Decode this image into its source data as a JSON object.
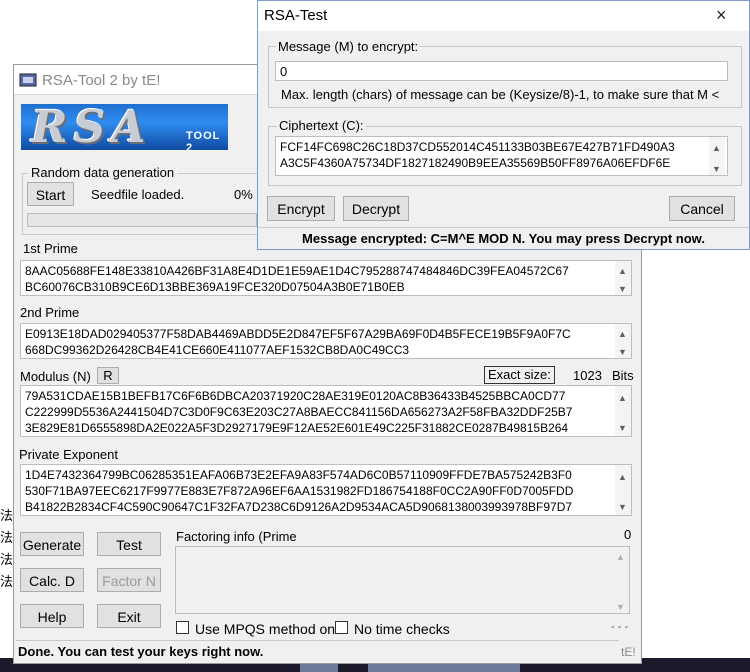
{
  "background": {
    "strip_chars": [
      "法",
      "法",
      "法",
      "法"
    ]
  },
  "main_window": {
    "title": "RSA-Tool 2 by tE!",
    "logo_text": "RSA",
    "logo_sub": "TOOL 2",
    "random_group": {
      "label": "Random data generation",
      "start_button": "Start",
      "status": "Seedfile loaded.",
      "percent": "0%",
      "progress": 0
    },
    "prime1": {
      "label": "1st Prime",
      "lines": [
        "8AAC05688FE148E33810A426BF31A8E4D1DE1E59AE1D4C795288747484846DC39FEA04572C67",
        "BC60076CB310B9CE6D13BBE369A19FCE320D07504A3B0E71B0EB"
      ]
    },
    "prime2": {
      "label": "2nd Prime",
      "lines": [
        "E0913E18DAD029405377F58DAB4469ABDD5E2D847EF5F67A29BA69F0D4B5FECE19B5F9A0F7C",
        "668DC99362D26428CB4E41CE660E411077AEF1532CB8DA0C49CC3"
      ]
    },
    "modulus": {
      "label": "Modulus (N)",
      "r_button": "R",
      "exact_size_label": "Exact size:",
      "exact_size_value": "1023",
      "bits_label": "Bits",
      "lines": [
        "79A531CDAE15B1BEFB17C6F6B6DBCA20371920C28AE319E0120AC8B36433B4525BBCA0CD77",
        "C222999D5536A2441504D7C3D0F9C63E203C27A8BAECC841156DA656273A2F58FBA32DDF25B7",
        "3E829E81D6555898DA2E022A5F3D2927179E9F12AE52E601E49C225F31882CE0287B49815B264"
      ]
    },
    "private_exponent": {
      "label": "Private Exponent",
      "lines": [
        "1D4E7432364799BC06285351EAFA06B73E2EFA9A83F574AD6C0B57110909FFDE7BA575242B3F0",
        "530F71BA97EEC6217F9977E883E7F872A96EF6AA1531982FD186754188F0CC2A90FF0D7005FDD",
        "B41822B2834CF4C590C90647C1F32FA7D238C6D9126A2D9534ACA5D9068138003993978BF97D7"
      ]
    },
    "buttons": {
      "generate": "Generate",
      "test": "Test",
      "calc_d": "Calc. D",
      "factor_n": "Factor N",
      "help": "Help",
      "exit": "Exit"
    },
    "factoring": {
      "label": "Factoring info (Prime",
      "count": "0",
      "use_mpqs": "Use MPQS method onl",
      "no_time_checks": "No time checks",
      "dashes": "- - -"
    },
    "status_bar": "Done. You can test your keys right now.",
    "signature": "tE!"
  },
  "test_dialog": {
    "title": "RSA-Test",
    "close_icon": "×",
    "message_label": "Message (M) to encrypt:",
    "message_value": "0",
    "max_length_note": "Max. length (chars) of message can be (Keysize/8)-1, to make sure that M <",
    "ciphertext_label": "Ciphertext (C):",
    "ciphertext_lines": [
      "FCF14FC698C26C18D37CD552014C451133B03BE67E427B71FD490A3",
      "A3C5F4360A75734DF1827182490B9EEA35569B50FF8976A06EFDF6E"
    ],
    "encrypt_button": "Encrypt",
    "decrypt_button": "Decrypt",
    "cancel_button": "Cancel",
    "status": "Message encrypted: C=M^E MOD N. You may press Decrypt now."
  }
}
